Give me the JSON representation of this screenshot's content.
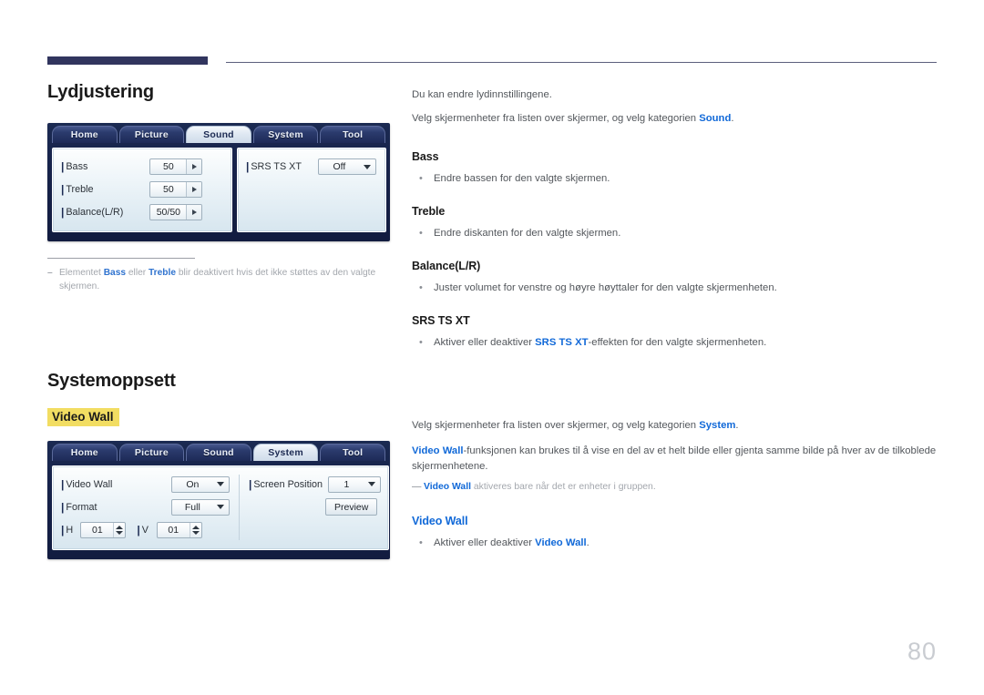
{
  "page": {
    "number": "80"
  },
  "sound_section": {
    "title": "Lydjustering",
    "intro1": "Du kan endre lydinnstillingene.",
    "intro2_pre": "Velg skjermenheter fra listen over skjermer, og velg kategorien ",
    "intro2_link": "Sound",
    "intro2_post": ".",
    "ui": {
      "tabs": [
        {
          "label": "Home",
          "active": false
        },
        {
          "label": "Picture",
          "active": false
        },
        {
          "label": "Sound",
          "active": true
        },
        {
          "label": "System",
          "active": false
        },
        {
          "label": "Tool",
          "active": false
        }
      ],
      "left_rows": [
        {
          "label": "Bass",
          "value": "50"
        },
        {
          "label": "Treble",
          "value": "50"
        },
        {
          "label": "Balance(L/R)",
          "value": "50/50"
        }
      ],
      "right_rows": [
        {
          "label": "SRS TS XT",
          "value": "Off"
        }
      ]
    },
    "note": {
      "dash": "–",
      "pre": "Elementet ",
      "b1": "Bass",
      "mid": " eller ",
      "b2": "Treble",
      "post": " blir deaktivert hvis det ikke støttes av den valgte skjermen."
    },
    "items": [
      {
        "head": "Bass",
        "bullet": "Endre bassen for den valgte skjermen."
      },
      {
        "head": "Treble",
        "bullet": "Endre diskanten for den valgte skjermen."
      },
      {
        "head": "Balance(L/R)",
        "bullet": "Juster volumet for venstre og høyre høyttaler for den valgte skjermenheten."
      },
      {
        "head": "SRS TS XT",
        "bullet_pre": "Aktiver eller deaktiver ",
        "bullet_link": "SRS TS XT",
        "bullet_post": "-effekten for den valgte skjermenheten."
      }
    ]
  },
  "system_section": {
    "title": "Systemoppsett",
    "highlight_label": "Video Wall",
    "intro1_pre": "Velg skjermenheter fra listen over skjermer, og velg kategorien ",
    "intro1_link": "System",
    "intro1_post": ".",
    "intro2_link": "Video Wall",
    "intro2_post": "-funksjonen kan brukes til å vise en del av et helt bilde eller gjenta samme bilde på hver av de tilkoblede skjermenhetene.",
    "note": {
      "dash": "—",
      "link": "Video Wall",
      "post": " aktiveres bare når det er enheter i gruppen."
    },
    "item": {
      "head": "Video Wall",
      "bullet_pre": "Aktiver eller deaktiver ",
      "bullet_link": "Video Wall",
      "bullet_post": "."
    },
    "ui": {
      "tabs": [
        {
          "label": "Home",
          "active": false
        },
        {
          "label": "Picture",
          "active": false
        },
        {
          "label": "Sound",
          "active": false
        },
        {
          "label": "System",
          "active": true
        },
        {
          "label": "Tool",
          "active": false
        }
      ],
      "video_wall_label": "Video Wall",
      "video_wall_value": "On",
      "format_label": "Format",
      "format_value": "Full",
      "h_label": "H",
      "h_value": "01",
      "v_label": "V",
      "v_value": "01",
      "screen_position_label": "Screen Position",
      "screen_position_value": "1",
      "preview_label": "Preview"
    }
  },
  "colors": {
    "accent_blue": "#1169d8",
    "highlight_yellow": "#f2dd62",
    "header_navy": "#31355e",
    "panel_navy": "#16224a"
  }
}
